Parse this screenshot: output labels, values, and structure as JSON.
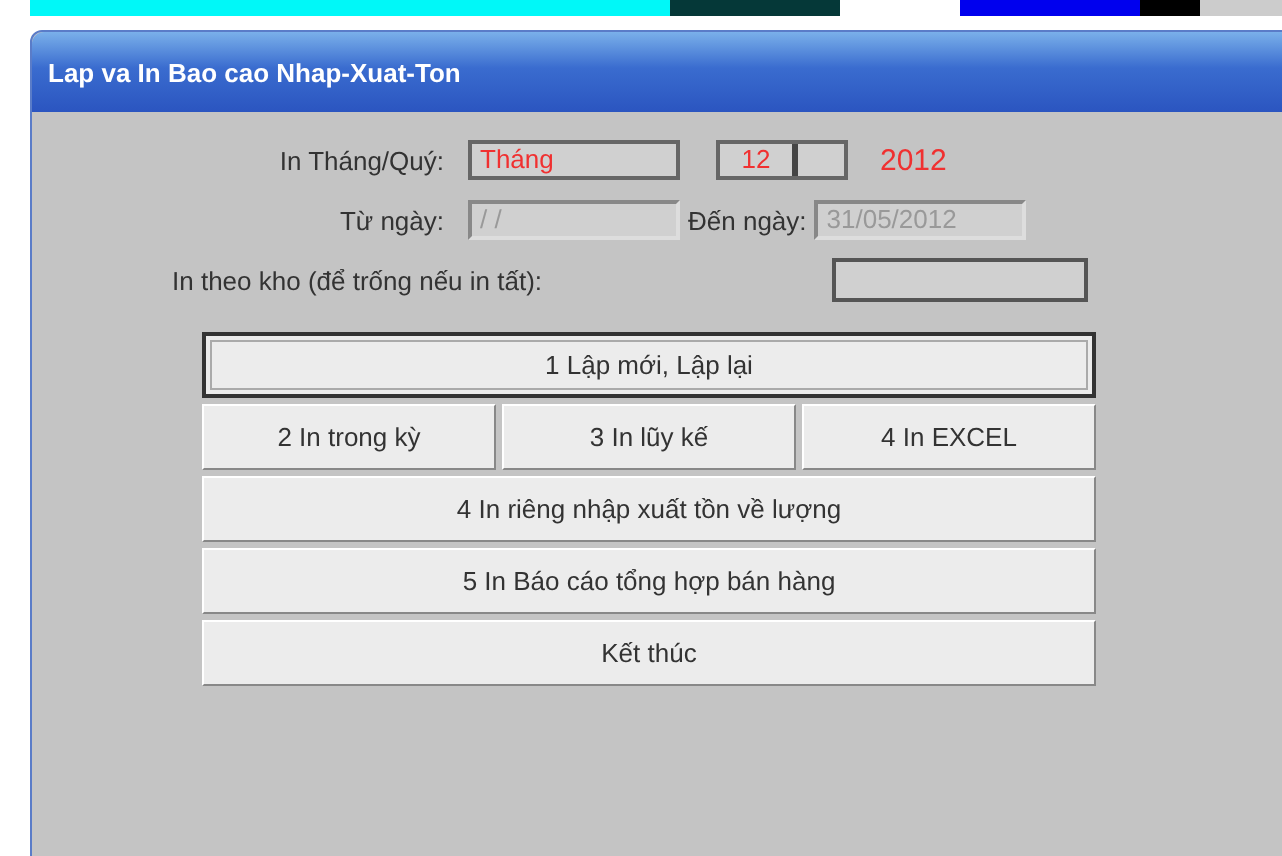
{
  "window": {
    "title": "Lap va In Bao cao Nhap-Xuat-Ton"
  },
  "period": {
    "label": "In Tháng/Quý:",
    "type_value": "Tháng",
    "month_value": "12",
    "year": "2012"
  },
  "date_range": {
    "from_label": "Từ ngày:",
    "from_value": " / /",
    "to_label": "Đến ngày:",
    "to_value": "31/05/2012"
  },
  "warehouse": {
    "label": "In theo kho (để trống nếu in tất):"
  },
  "button_rows": [
    [
      {
        "label": "1 Lập mới, Lập lại",
        "focused": true
      }
    ],
    [
      {
        "label": "2 In trong kỳ",
        "focused": false
      },
      {
        "label": "3 In lũy kế",
        "focused": false
      },
      {
        "label": "4 In EXCEL",
        "focused": false
      }
    ],
    [
      {
        "label": "4 In riêng nhập xuất tồn về lượng",
        "focused": false
      }
    ],
    [
      {
        "label": "5 In Báo cáo tổng hợp bán hàng",
        "focused": false
      }
    ],
    [
      {
        "label": "Kết thúc",
        "focused": false
      }
    ]
  ]
}
